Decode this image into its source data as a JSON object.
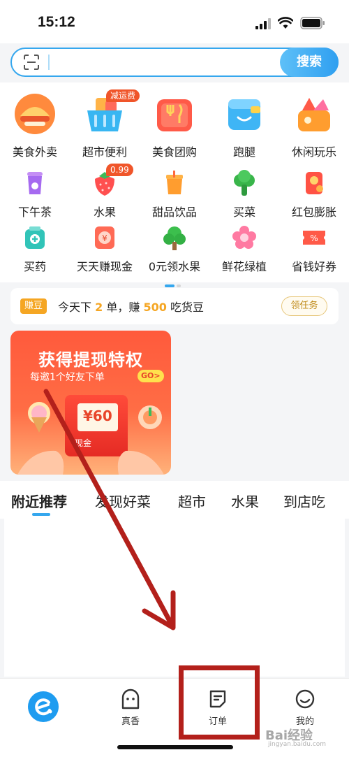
{
  "status": {
    "time": "15:12"
  },
  "search": {
    "placeholder": "",
    "button_label": "搜索"
  },
  "categories_big": [
    {
      "label": "美食外卖",
      "icon": "food-delivery-icon"
    },
    {
      "label": "超市便利",
      "icon": "shopping-basket-icon",
      "badge": "减运费"
    },
    {
      "label": "美食团购",
      "icon": "group-buy-icon"
    },
    {
      "label": "跑腿",
      "icon": "errand-bag-icon"
    },
    {
      "label": "休闲玩乐",
      "icon": "leisure-icon"
    }
  ],
  "categories_row2": [
    {
      "label": "下午茶",
      "icon": "tea-cup-icon"
    },
    {
      "label": "水果",
      "icon": "strawberry-icon",
      "badge": "0.99"
    },
    {
      "label": "甜品饮品",
      "icon": "drink-icon"
    },
    {
      "label": "买菜",
      "icon": "vegetable-icon"
    },
    {
      "label": "红包膨胀",
      "icon": "red-packet-icon"
    }
  ],
  "categories_row3": [
    {
      "label": "买药",
      "icon": "medicine-icon"
    },
    {
      "label": "天天赚现金",
      "icon": "cash-coin-icon"
    },
    {
      "label": "0元领水果",
      "icon": "tree-icon"
    },
    {
      "label": "鲜花绿植",
      "icon": "flower-icon"
    },
    {
      "label": "省钱好券",
      "icon": "coupon-icon"
    }
  ],
  "task": {
    "tag": "赚豆",
    "text_prefix": "今天下",
    "count": "2",
    "text_mid": "单，赚",
    "reward": "500",
    "text_suffix": "吃货豆",
    "button": "领任务"
  },
  "promo": {
    "title": "获得提现特权",
    "subtitle": "每邀1个好友下单",
    "go": "GO>",
    "amount": "¥60",
    "cash_label": "现金"
  },
  "tabs": [
    "附近推荐",
    "发现好菜",
    "超市",
    "水果",
    "到店吃"
  ],
  "nav": {
    "items": [
      {
        "label": "",
        "icon": "eleme-home-icon"
      },
      {
        "label": "真香",
        "icon": "ghost-face-icon"
      },
      {
        "label": "订单",
        "icon": "order-note-icon"
      },
      {
        "label": "我的",
        "icon": "smile-face-icon"
      }
    ]
  },
  "watermark": {
    "brand": "Bai经验",
    "url": "jingyan.baidu.com"
  },
  "colors": {
    "accent": "#35a7ee",
    "annotation_red": "#b3201b",
    "promo_red": "#ff5a3c",
    "task_orange": "#f5a623"
  }
}
